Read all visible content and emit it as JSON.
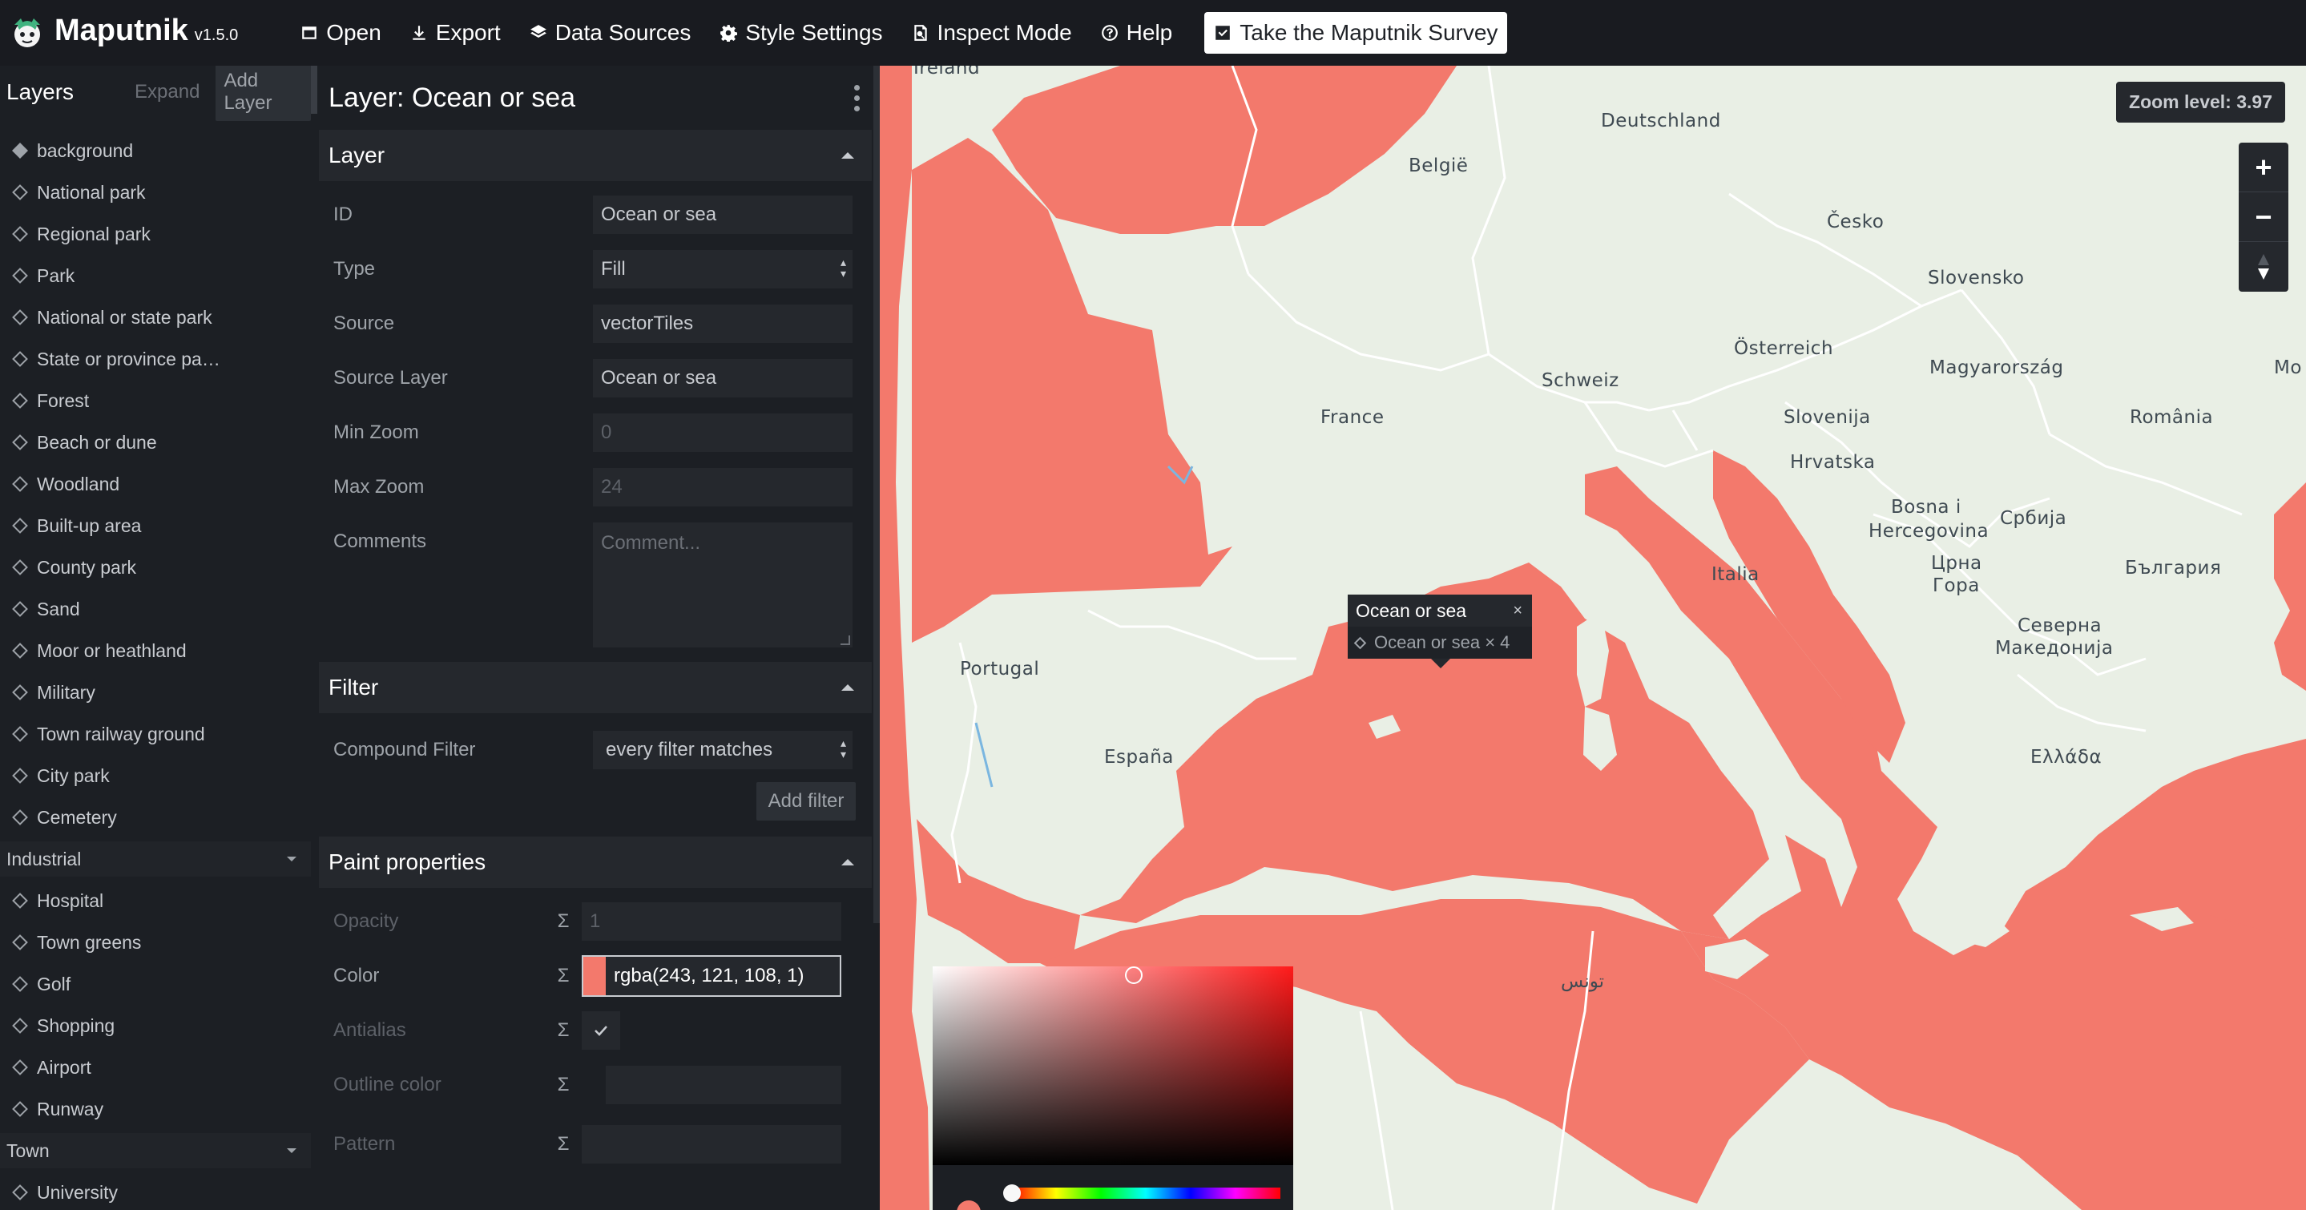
{
  "app": {
    "name": "Maputnik",
    "version": "v1.5.0"
  },
  "toolbar": {
    "open_label": "Open",
    "export_label": "Export",
    "data_sources_label": "Data Sources",
    "style_settings_label": "Style Settings",
    "inspect_mode_label": "Inspect Mode",
    "help_label": "Help",
    "survey_label": "Take the Maputnik Survey"
  },
  "layer_list": {
    "title": "Layers",
    "expand_label": "Expand",
    "add_layer_label": "Add Layer",
    "items_a": [
      {
        "label": "background"
      },
      {
        "label": "National park"
      },
      {
        "label": "Regional park"
      },
      {
        "label": "Park"
      },
      {
        "label": "National or state park"
      },
      {
        "label": "State or province pa…"
      },
      {
        "label": "Forest"
      },
      {
        "label": "Beach or dune"
      },
      {
        "label": "Woodland"
      },
      {
        "label": "Built-up area"
      },
      {
        "label": "County park"
      },
      {
        "label": "Sand"
      },
      {
        "label": "Moor or heathland"
      },
      {
        "label": "Military"
      },
      {
        "label": "Town railway ground"
      },
      {
        "label": "City park"
      },
      {
        "label": "Cemetery"
      }
    ],
    "group_industrial": "Industrial",
    "items_b": [
      {
        "label": "Hospital"
      },
      {
        "label": "Town greens"
      },
      {
        "label": "Golf"
      },
      {
        "label": "Shopping"
      },
      {
        "label": "Airport"
      },
      {
        "label": "Runway"
      }
    ],
    "group_town": "Town",
    "items_c": [
      {
        "label": "University"
      }
    ]
  },
  "editor": {
    "title": "Layer: Ocean or sea",
    "layer_section": {
      "title": "Layer",
      "id_label": "ID",
      "id_value": "Ocean or sea",
      "type_label": "Type",
      "type_value": "Fill",
      "source_label": "Source",
      "source_value": "vectorTiles",
      "source_layer_label": "Source Layer",
      "source_layer_value": "Ocean or sea",
      "min_zoom_label": "Min Zoom",
      "min_zoom_placeholder": "0",
      "max_zoom_label": "Max Zoom",
      "max_zoom_placeholder": "24",
      "comments_label": "Comments",
      "comments_placeholder": "Comment..."
    },
    "filter_section": {
      "title": "Filter",
      "compound_label": "Compound Filter",
      "compound_value": "every filter matches",
      "add_filter_label": "Add filter"
    },
    "paint_section": {
      "title": "Paint properties",
      "sigma": "Σ",
      "opacity_label": "Opacity",
      "opacity_placeholder": "1",
      "color_label": "Color",
      "color_value": "rgba(243, 121, 108, 1)",
      "antialias_label": "Antialias",
      "outline_color_label": "Outline color",
      "pattern_label": "Pattern"
    }
  },
  "map": {
    "zoom_label": "Zoom level: 3.97",
    "zoom_in": "+",
    "zoom_out": "−",
    "labels": {
      "ireland": "Ireland",
      "deutschland": "Deutschland",
      "belgie": "België",
      "cesko": "Česko",
      "slovensko": "Slovensko",
      "osterreich": "Österreich",
      "magyarorszag": "Magyarország",
      "mo": "Mo",
      "schweiz": "Schweiz",
      "france": "France",
      "slovenija": "Slovenija",
      "romania": "România",
      "hrvatska": "Hrvatska",
      "bosna1": "Bosna i",
      "bosna2": "Hercegovina",
      "srbija": "Србија",
      "crna1": "Црна",
      "crna2": "Гора",
      "bulgaria": "България",
      "italia": "Italia",
      "portugal": "Portugal",
      "severna1": "Северна",
      "severna2": "Македонија",
      "espana": "España",
      "ellada": "Ελλάδα",
      "tunis": "تونس"
    },
    "popup": {
      "title": "Ocean or sea",
      "close": "×",
      "row": "Ocean or sea × 4"
    }
  },
  "colors": {
    "sea": "#f3796c",
    "land": "#e9efe5",
    "border": "#ffffff",
    "panel": "#1c1f24",
    "toolbar": "#191b20"
  }
}
